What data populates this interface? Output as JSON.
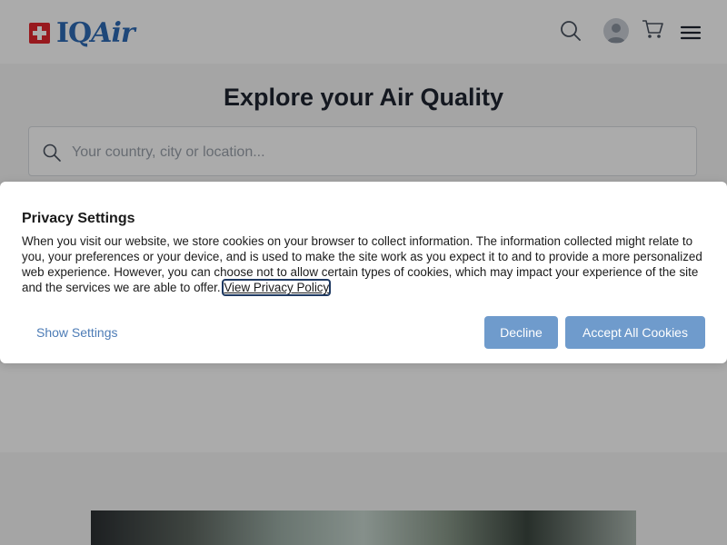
{
  "header": {
    "logo_text_iq": "IQ",
    "logo_text_air": "Air",
    "icons": [
      "search-icon",
      "avatar-icon",
      "cart-icon",
      "menu-icon"
    ]
  },
  "hero": {
    "title": "Explore your Air Quality",
    "search_placeholder": "Your country, city or location..."
  },
  "privacy": {
    "title": "Privacy Settings",
    "body": "When you visit our website, we store cookies on your browser to collect information. The information collected might relate to you, your preferences or your device, and is used to make the site work as you expect it to and to provide a more personalized web experience. However, you can choose not to allow certain types of cookies, which may impact your experience of the site and the services we are able to offer.",
    "policy_link": "View Privacy Policy",
    "show_settings": "Show Settings",
    "decline": "Decline",
    "accept": "Accept All Cookies"
  },
  "colors": {
    "brand_blue": "#2e6ab5",
    "swiss_red": "#e3262d",
    "button_blue": "#6f9bcc",
    "link_blue": "#4d7cb6"
  }
}
